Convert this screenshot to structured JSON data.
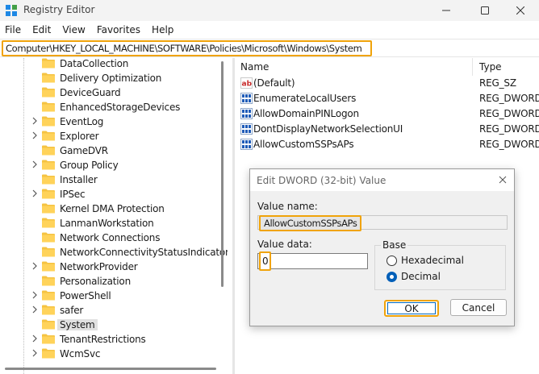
{
  "window": {
    "title": "Registry Editor",
    "minimize_glyph": "—",
    "maximize_glyph": "☐",
    "close_glyph": "✕"
  },
  "menubar": {
    "items": [
      "File",
      "Edit",
      "View",
      "Favorites",
      "Help"
    ]
  },
  "address": {
    "path": "Computer\\HKEY_LOCAL_MACHINE\\SOFTWARE\\Policies\\Microsoft\\Windows\\System"
  },
  "tree": {
    "items": [
      {
        "label": "DataCollection",
        "has_children": false,
        "selected": false
      },
      {
        "label": "Delivery Optimization",
        "has_children": false,
        "selected": false
      },
      {
        "label": "DeviceGuard",
        "has_children": false,
        "selected": false
      },
      {
        "label": "EnhancedStorageDevices",
        "has_children": false,
        "selected": false
      },
      {
        "label": "EventLog",
        "has_children": true,
        "selected": false
      },
      {
        "label": "Explorer",
        "has_children": true,
        "selected": false
      },
      {
        "label": "GameDVR",
        "has_children": false,
        "selected": false
      },
      {
        "label": "Group Policy",
        "has_children": true,
        "selected": false
      },
      {
        "label": "Installer",
        "has_children": false,
        "selected": false
      },
      {
        "label": "IPSec",
        "has_children": true,
        "selected": false
      },
      {
        "label": "Kernel DMA Protection",
        "has_children": false,
        "selected": false
      },
      {
        "label": "LanmanWorkstation",
        "has_children": false,
        "selected": false
      },
      {
        "label": "Network Connections",
        "has_children": false,
        "selected": false
      },
      {
        "label": "NetworkConnectivityStatusIndicator",
        "has_children": false,
        "selected": false
      },
      {
        "label": "NetworkProvider",
        "has_children": true,
        "selected": false
      },
      {
        "label": "Personalization",
        "has_children": false,
        "selected": false
      },
      {
        "label": "PowerShell",
        "has_children": true,
        "selected": false
      },
      {
        "label": "safer",
        "has_children": true,
        "selected": false
      },
      {
        "label": "System",
        "has_children": false,
        "selected": true
      },
      {
        "label": "TenantRestrictions",
        "has_children": true,
        "selected": false
      },
      {
        "label": "WcmSvc",
        "has_children": true,
        "selected": false
      }
    ]
  },
  "values_list": {
    "headers": {
      "name": "Name",
      "type": "Type"
    },
    "rows": [
      {
        "icon": "string-value-icon",
        "name": "(Default)",
        "type": "REG_SZ"
      },
      {
        "icon": "dword-value-icon",
        "name": "EnumerateLocalUsers",
        "type": "REG_DWORD"
      },
      {
        "icon": "dword-value-icon",
        "name": "AllowDomainPINLogon",
        "type": "REG_DWORD"
      },
      {
        "icon": "dword-value-icon",
        "name": "DontDisplayNetworkSelectionUI",
        "type": "REG_DWORD"
      },
      {
        "icon": "dword-value-icon",
        "name": "AllowCustomSSPsAPs",
        "type": "REG_DWORD"
      }
    ]
  },
  "dialog": {
    "title": "Edit DWORD (32-bit) Value",
    "value_name_label": "Value name:",
    "value_name": "AllowCustomSSPsAPs",
    "value_data_label": "Value data:",
    "value_data": "0",
    "base_label": "Base",
    "base_options": [
      "Hexadecimal",
      "Decimal"
    ],
    "base_selected": "Decimal",
    "ok_label": "OK",
    "cancel_label": "Cancel",
    "close_glyph": "✕"
  },
  "colors": {
    "highlight": "#f0a30a",
    "folder": "#f5c342",
    "accent": "#005fb8"
  }
}
